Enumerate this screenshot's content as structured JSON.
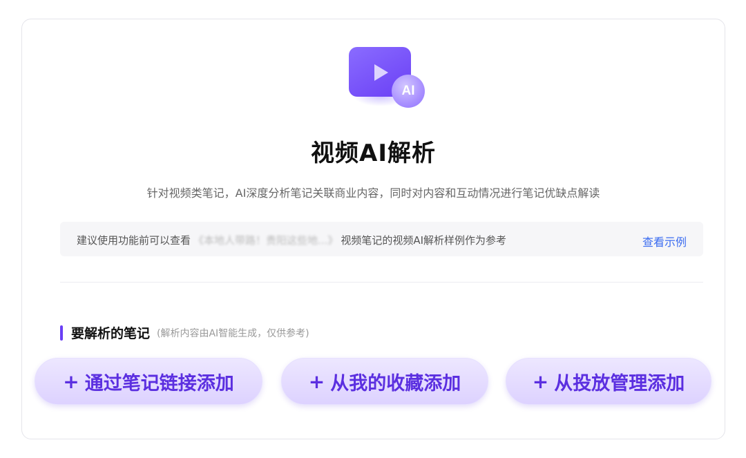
{
  "hero": {
    "icon_name": "video-ai-icon",
    "badge": "AI",
    "title": "视频AI解析",
    "subtitle": "针对视频类笔记，AI深度分析笔记关联商业内容，同时对内容和互动情况进行笔记优缺点解读"
  },
  "notice": {
    "prefix": "建议使用功能前可以查看",
    "example_name": "《本地人带路！贵阳这些地...》",
    "suffix": "视频笔记的视频AI解析样例作为参考",
    "link_label": "查看示例"
  },
  "section": {
    "title": "要解析的笔记",
    "note": "(解析内容由AI智能生成，仅供参考)"
  },
  "buttons": [
    {
      "plus": "+",
      "label": "通过笔记链接添加"
    },
    {
      "plus": "+",
      "label": "从我的收藏添加"
    },
    {
      "plus": "+",
      "label": "从投放管理添加"
    }
  ],
  "colors": {
    "accent": "#6a3ff5",
    "link": "#3b6cf0",
    "button_text": "#5b2fe0"
  }
}
